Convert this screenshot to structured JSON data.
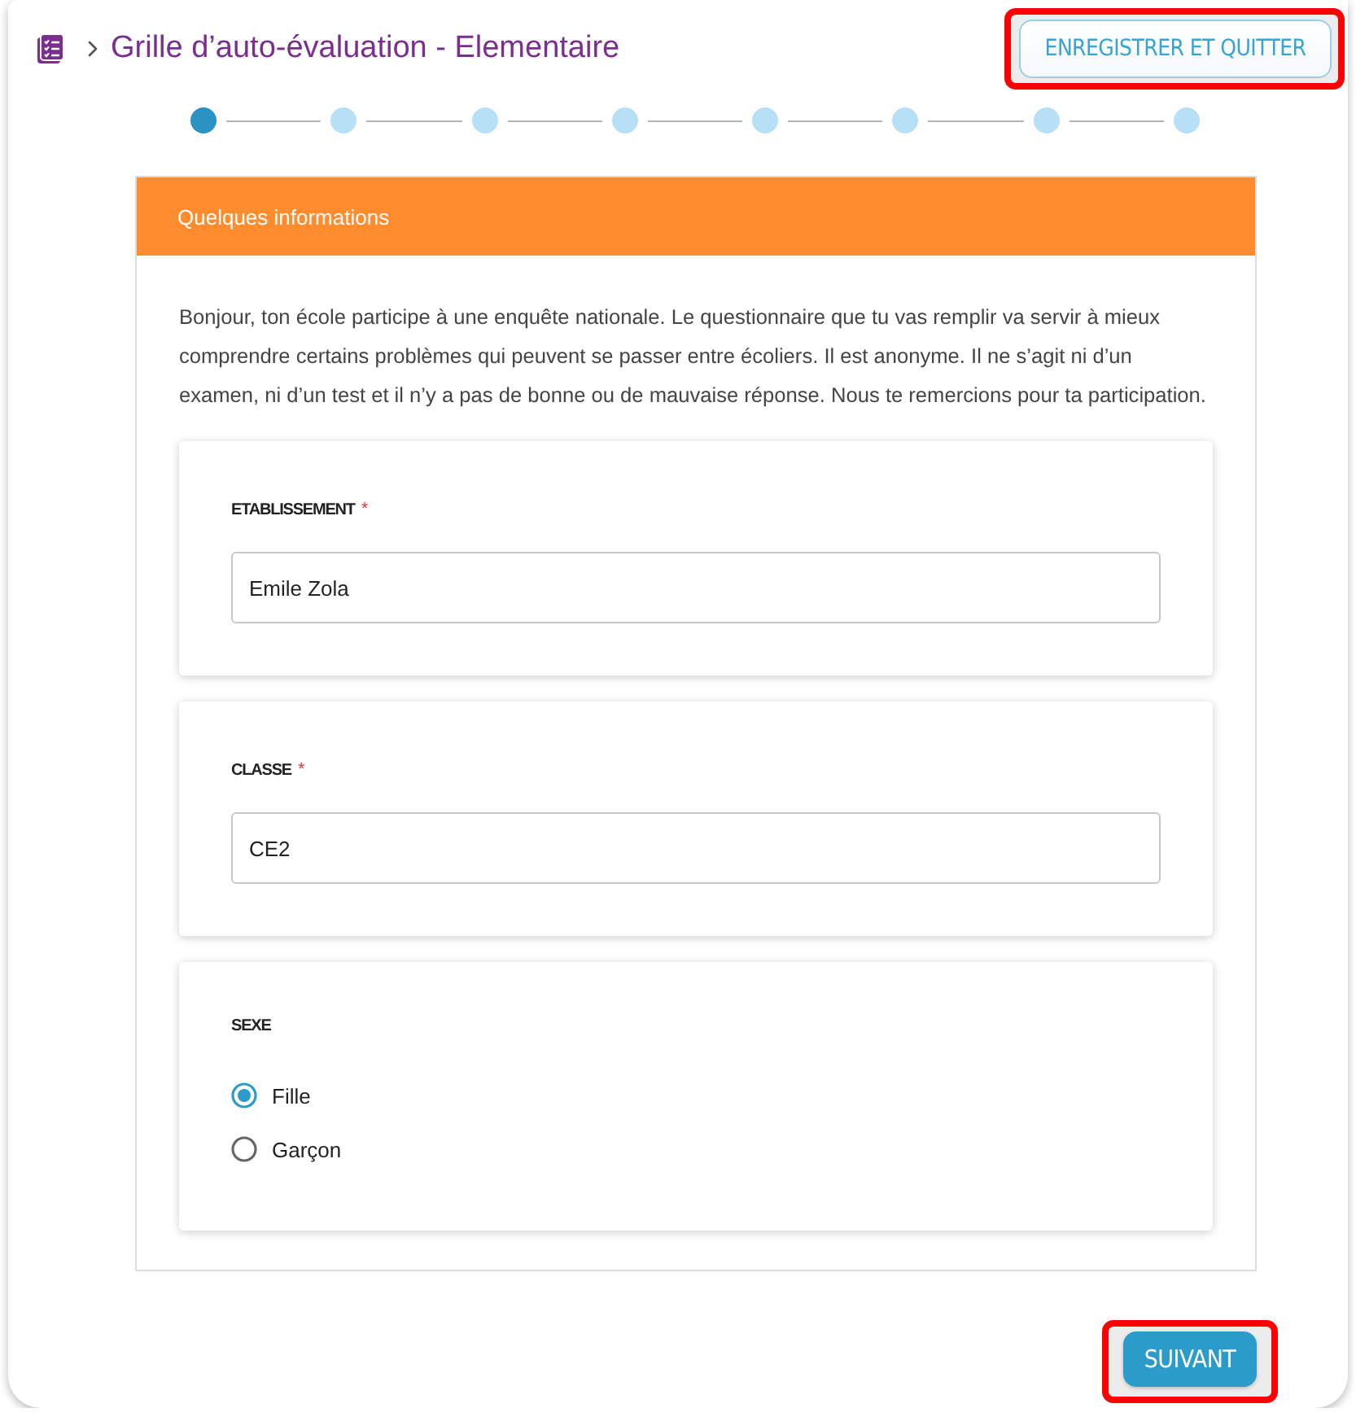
{
  "header": {
    "title": "Grille d’auto-évaluation - Elementaire",
    "save_button": {
      "label": "ENREGISTRER ET QUITTER",
      "highlighted": true
    }
  },
  "steps": [
    {
      "selected": true
    },
    {
      "selected": false
    },
    {
      "selected": false
    },
    {
      "selected": false
    },
    {
      "selected": false
    },
    {
      "selected": false
    },
    {
      "selected": false
    },
    {
      "selected": false
    }
  ],
  "section": {
    "title": "Quelques informations",
    "intro": "Bonjour, ton école participe à une enquête nationale. Le questionnaire que tu vas remplir va servir à mieux comprendre certains problèmes qui peuvent se passer entre écoliers. Il est anonyme. Il ne s’agit ni d’un examen, ni d’un test et il n’y a pas de bonne ou de mauvaise réponse. Nous te remercions pour ta participation.",
    "fields": [
      {
        "kind": "text",
        "label": "ETABLISSEMENT",
        "required_mark": "*",
        "value": "Emile Zola"
      },
      {
        "kind": "text",
        "label": "CLASSE",
        "required_mark": "*",
        "value": "CE2"
      },
      {
        "kind": "radio",
        "label": "SEXE",
        "options": [
          {
            "label": "Fille",
            "selected": true
          },
          {
            "label": "Garçon",
            "selected": false
          }
        ]
      }
    ]
  },
  "next_button": {
    "label": "SUIVANT",
    "highlighted": true
  }
}
